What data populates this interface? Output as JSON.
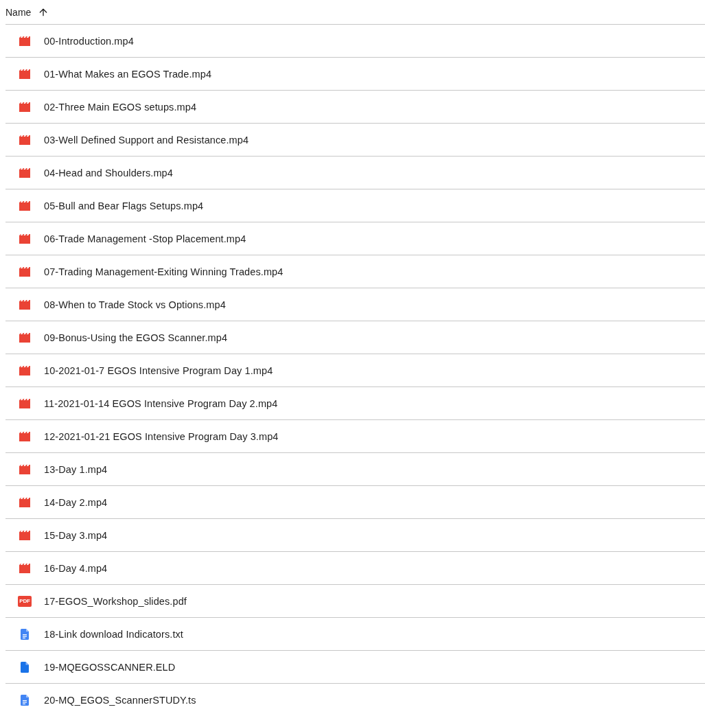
{
  "header": {
    "column": "Name",
    "sort_ascending": true
  },
  "files": [
    {
      "kind": "video",
      "name": "00-Introduction.mp4"
    },
    {
      "kind": "video",
      "name": "01-What Makes an EGOS Trade.mp4"
    },
    {
      "kind": "video",
      "name": "02-Three Main EGOS setups.mp4"
    },
    {
      "kind": "video",
      "name": "03-Well Defined Support and Resistance.mp4"
    },
    {
      "kind": "video",
      "name": "04-Head and Shoulders.mp4"
    },
    {
      "kind": "video",
      "name": "05-Bull and Bear Flags Setups.mp4"
    },
    {
      "kind": "video",
      "name": "06-Trade Management -Stop Placement.mp4"
    },
    {
      "kind": "video",
      "name": "07-Trading Management-Exiting Winning Trades.mp4"
    },
    {
      "kind": "video",
      "name": "08-When to Trade Stock vs Options.mp4"
    },
    {
      "kind": "video",
      "name": "09-Bonus-Using the EGOS Scanner.mp4"
    },
    {
      "kind": "video",
      "name": "10-2021-01-7 EGOS Intensive Program Day 1.mp4"
    },
    {
      "kind": "video",
      "name": "11-2021-01-14 EGOS Intensive Program Day 2.mp4"
    },
    {
      "kind": "video",
      "name": "12-2021-01-21 EGOS Intensive Program Day 3.mp4"
    },
    {
      "kind": "video",
      "name": "13-Day 1.mp4"
    },
    {
      "kind": "video",
      "name": "14-Day 2.mp4"
    },
    {
      "kind": "video",
      "name": "15-Day 3.mp4"
    },
    {
      "kind": "video",
      "name": "16-Day 4.mp4"
    },
    {
      "kind": "pdf",
      "name": "17-EGOS_Workshop_slides.pdf",
      "icon_text": "PDF"
    },
    {
      "kind": "doc",
      "name": "18-Link download Indicators.txt"
    },
    {
      "kind": "file",
      "name": "19-MQEGOSSCANNER.ELD"
    },
    {
      "kind": "doc",
      "name": "20-MQ_EGOS_ScannerSTUDY.ts"
    }
  ]
}
